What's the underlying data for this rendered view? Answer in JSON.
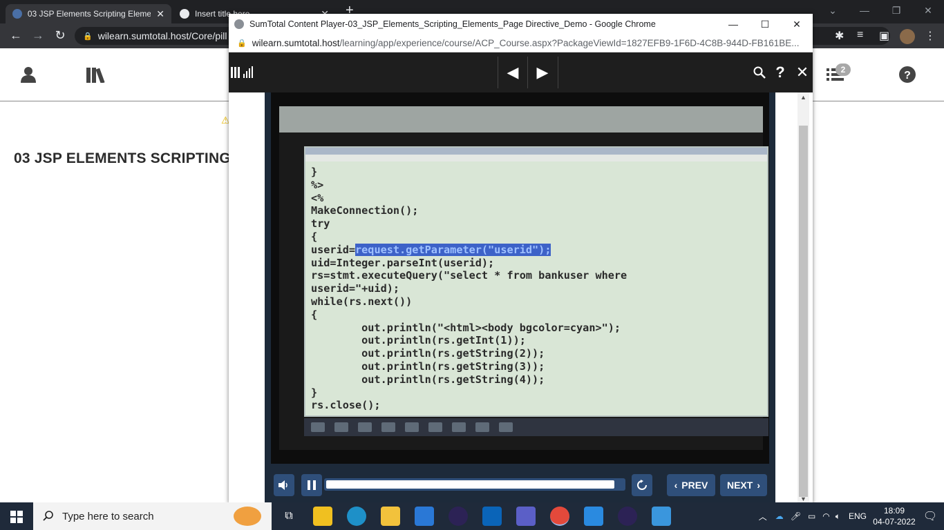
{
  "browser": {
    "tabs": [
      {
        "title": "03 JSP Elements Scripting Elemen",
        "active": true
      },
      {
        "title": "Insert title here",
        "active": false
      }
    ],
    "url": "wilearn.sumtotal.host/Core/pill"
  },
  "lms": {
    "page_title": "03 JSP ELEMENTS SCRIPTING",
    "notification_count": "2"
  },
  "popup": {
    "window_title": "SumTotal Content Player-03_JSP_Elements_Scripting_Elements_Page Directive_Demo - Google Chrome",
    "url_domain": "wilearn.sumtotal.host",
    "url_path": "/learning/app/experience/course/ACP_Course.aspx?PackageViewId=1827EFB9-1F6D-4C8B-944D-FB161BE..."
  },
  "video": {
    "code_lines": [
      "}",
      "%>",
      "<%",
      "MakeConnection();",
      "try",
      "{",
      "userid=|request.getParameter(\"userid\");",
      "uid=Integer.parseInt(userid);",
      "rs=stmt.executeQuery(\"select * from bankuser where",
      "userid=\"+uid);",
      "while(rs.next())",
      "{",
      "        out.println(\"<html><body bgcolor=cyan>\");",
      "        out.println(rs.getInt(1));",
      "        out.println(rs.getString(2));",
      "        out.println(rs.getString(3));",
      "        out.println(rs.getString(4));",
      "}",
      "rs.close();"
    ]
  },
  "controls": {
    "prev_label": "PREV",
    "next_label": "NEXT",
    "progress": 0.97
  },
  "taskbar": {
    "search_placeholder": "Type here to search",
    "language": "ENG",
    "time": "18:09",
    "date": "04-07-2022"
  },
  "colors": {
    "chrome_dark": "#202124",
    "player_toolbar": "#1e1e1e",
    "player_button": "#2f4f7a",
    "code_highlight": "#3d62c8",
    "taskbar": "#1f2a3a"
  }
}
